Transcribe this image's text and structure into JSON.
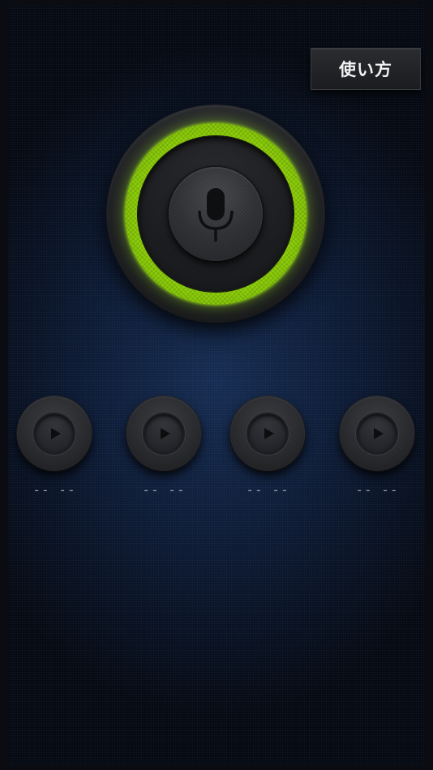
{
  "header": {
    "howto_label": "使い方"
  },
  "recorder": {
    "ring_color": "#9bdc14",
    "mic_icon": "microphone-icon"
  },
  "slots": [
    {
      "label": "-- --",
      "icon": "play-icon"
    },
    {
      "label": "-- --",
      "icon": "play-icon"
    },
    {
      "label": "-- --",
      "icon": "play-icon"
    },
    {
      "label": "-- --",
      "icon": "play-icon"
    }
  ]
}
